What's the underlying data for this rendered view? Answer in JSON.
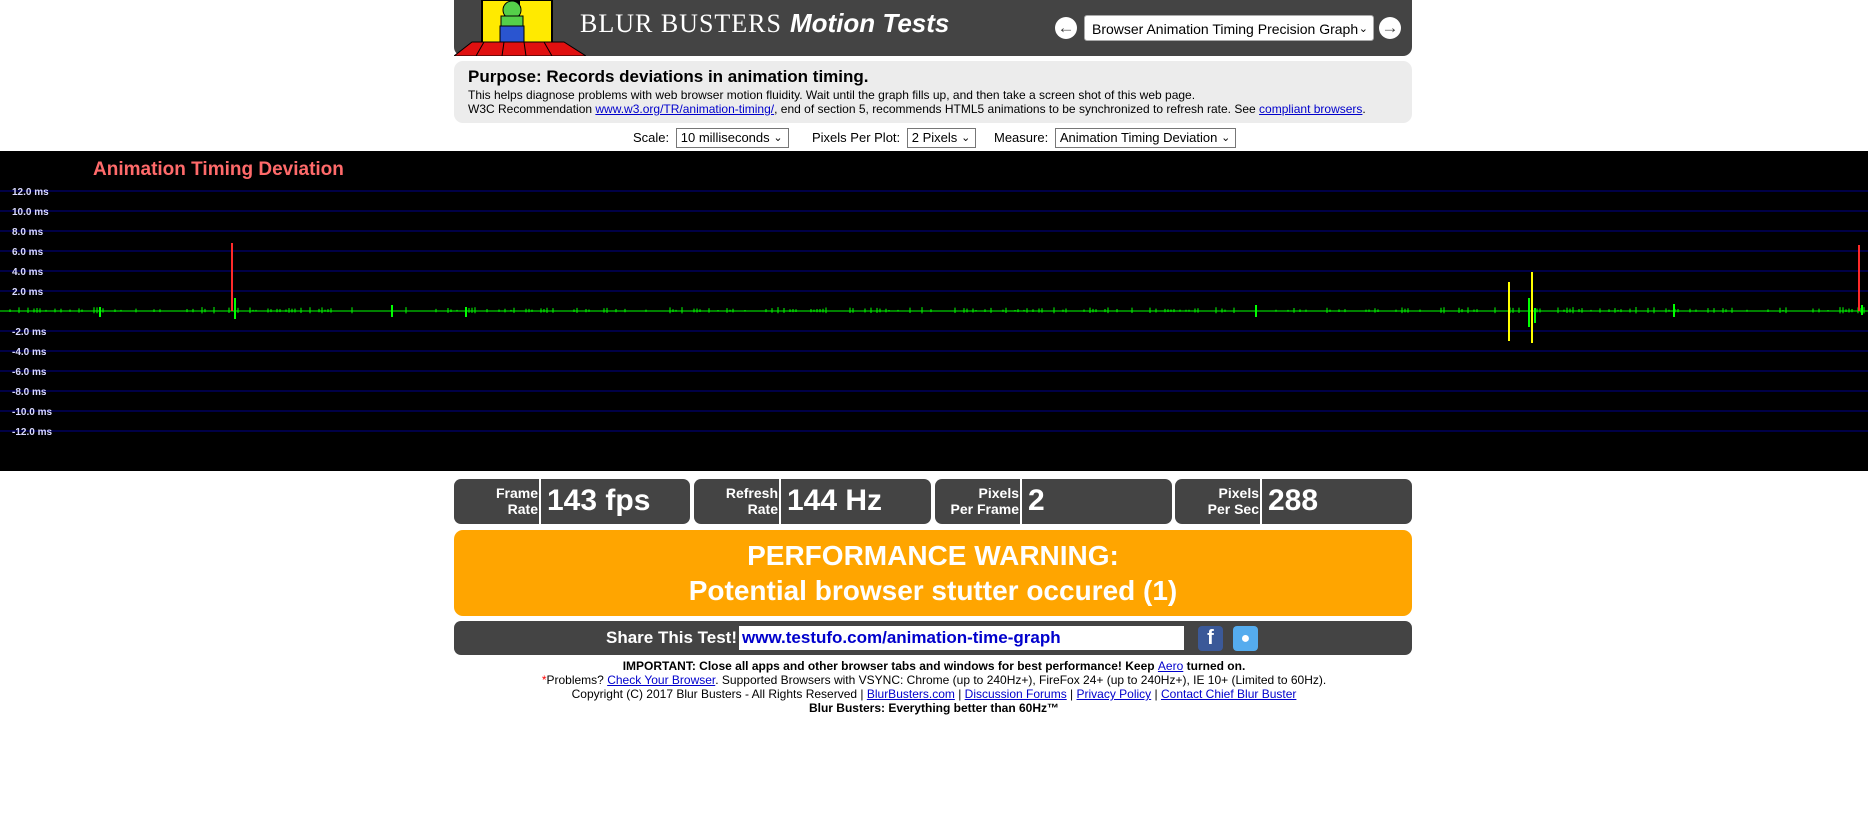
{
  "header": {
    "brand": "BLUR BUSTERS",
    "brand_suffix": "Motion Tests",
    "prev_icon": "arrow-left-icon",
    "next_icon": "arrow-right-icon",
    "test_selector": "Browser Animation Timing Precision Graph"
  },
  "purpose": {
    "heading": "Purpose: Records deviations in animation timing.",
    "line1": "This helps diagnose problems with web browser motion fluidity. Wait until the graph fills up, and then take a screen shot of this web page.",
    "line2_prefix": "W3C Recommendation ",
    "line2_link": "www.w3.org/TR/animation-timing/",
    "line2_middle": ", end of section 5, recommends HTML5 animations to be synchronized to refresh rate. See ",
    "line2_link2": "compliant browsers",
    "line2_suffix": "."
  },
  "controls": {
    "scale_label": "Scale:",
    "scale_value": "10 milliseconds",
    "ppp_label": "Pixels Per Plot:",
    "ppp_value": "2 Pixels",
    "measure_label": "Measure:",
    "measure_value": "Animation Timing Deviation"
  },
  "chart_data": {
    "type": "line",
    "title": "Animation Timing Deviation",
    "ylabel": "",
    "ylim": [
      -12,
      12
    ],
    "y_ticks": [
      "12.0 ms",
      "10.0 ms",
      "8.0 ms",
      "6.0 ms",
      "4.0 ms",
      "2.0 ms",
      "-2.0 ms",
      "-4.0 ms",
      "-6.0 ms",
      "-8.0 ms",
      "-10.0 ms",
      "-12.0 ms"
    ],
    "y_tick_values": [
      12,
      10,
      8,
      6,
      4,
      2,
      -2,
      -4,
      -6,
      -8,
      -10,
      -12
    ],
    "grid": true,
    "baseline_color": "#00ff00",
    "spikes": [
      {
        "x": 100,
        "top": 0.4,
        "bottom": -0.6,
        "color": "#00ff00"
      },
      {
        "x": 232,
        "top": 6.8,
        "bottom": 0,
        "color": "#ff2a2a"
      },
      {
        "x": 235,
        "top": 1.3,
        "bottom": -0.8,
        "color": "#00ff00"
      },
      {
        "x": 392,
        "top": 0.6,
        "bottom": -0.6,
        "color": "#00ff00"
      },
      {
        "x": 466,
        "top": 0.4,
        "bottom": -0.6,
        "color": "#00ff00"
      },
      {
        "x": 1256,
        "top": 0.6,
        "bottom": -0.6,
        "color": "#00ff00"
      },
      {
        "x": 1509,
        "top": 2.9,
        "bottom": -3.0,
        "color": "#ffff00"
      },
      {
        "x": 1529,
        "top": 1.3,
        "bottom": -1.6,
        "color": "#00ff00"
      },
      {
        "x": 1532,
        "top": 3.9,
        "bottom": -3.2,
        "color": "#ffff00"
      },
      {
        "x": 1535,
        "top": 0.3,
        "bottom": -1.2,
        "color": "#00ff00"
      },
      {
        "x": 1674,
        "top": 0.7,
        "bottom": -0.6,
        "color": "#00ff00"
      },
      {
        "x": 1859,
        "top": 6.6,
        "bottom": 0,
        "color": "#ff2a2a"
      },
      {
        "x": 1862,
        "top": 0.6,
        "bottom": -0.4,
        "color": "#00ff00"
      }
    ]
  },
  "stats": [
    {
      "label1": "Frame",
      "label2": "Rate",
      "value": "143 fps"
    },
    {
      "label1": "Refresh",
      "label2": "Rate",
      "value": "144 Hz"
    },
    {
      "label1": "Pixels",
      "label2": "Per Frame",
      "value": "2"
    },
    {
      "label1": "Pixels",
      "label2": "Per Sec",
      "value": "288"
    }
  ],
  "warning": {
    "line1": "PERFORMANCE WARNING:",
    "line2": "Potential browser stutter occured (1)"
  },
  "share": {
    "label": "Share This Test!",
    "url": "www.testufo.com/animation-time-graph",
    "facebook_icon": "facebook-icon",
    "twitter_icon": "twitter-icon",
    "facebook_color": "#3b5998",
    "twitter_color": "#55acee"
  },
  "footer": {
    "important": "IMPORTANT: Close all apps and other browser tabs and windows for best performance! Keep ",
    "aero_link": "Aero",
    "important_end": " turned on.",
    "star": "*",
    "problems": "Problems? ",
    "check_link": "Check Your Browser",
    "supported": ". Supported Browsers with VSYNC: Chrome (up to 240Hz+), FireFox 24+ (up to 240Hz+), IE 10+ (Limited to 60Hz).",
    "copyright": "Copyright (C) 2017 Blur Busters - All Rights Reserved | ",
    "link_bb": "BlurBusters.com",
    "sep": " | ",
    "link_forums": "Discussion Forums",
    "link_privacy": "Privacy Policy",
    "link_contact": "Contact Chief Blur Buster",
    "tagline": "Blur Busters: Everything better than 60Hz™"
  },
  "colors": {
    "panel": "#444444",
    "warning": "#ffa500",
    "graph_bg": "#000000",
    "grid": "#00008b",
    "title": "#ff6a6a"
  }
}
